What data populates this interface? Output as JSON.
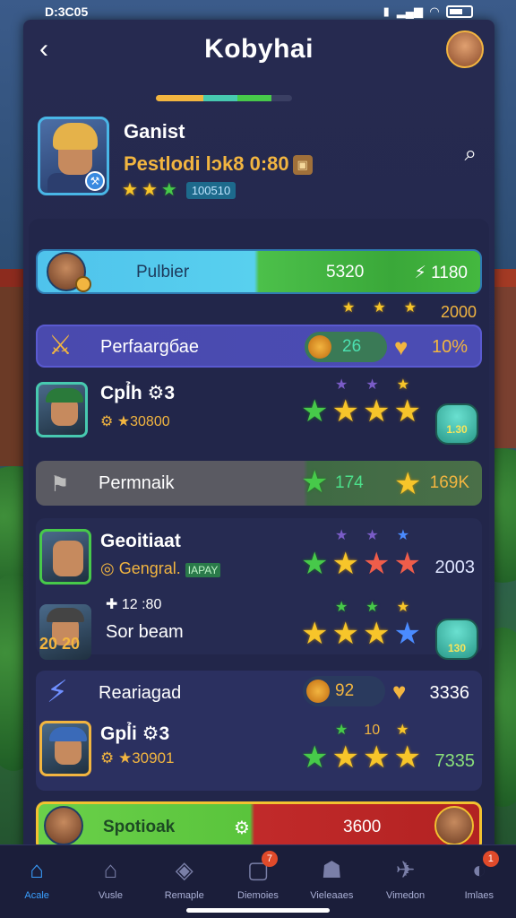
{
  "status_bar": {
    "time": "D:3C05"
  },
  "header": {
    "title": "Kobyhai"
  },
  "progress_segments": [
    {
      "color": "#f2b540",
      "fraction": 0.35
    },
    {
      "color": "#47c9b0",
      "fraction": 0.25
    },
    {
      "color": "#47c94a",
      "fraction": 0.25
    }
  ],
  "profile": {
    "name": "Ganist",
    "subtitle": "Pestlodi lɔk8 0:80",
    "score": "100510"
  },
  "rows": {
    "r1": {
      "label": "Pulbier",
      "value1": "5320",
      "value2": "⚡ 1180"
    },
    "r1b": {
      "value": "2000"
    },
    "r2": {
      "label": "Perfaargбае",
      "pill": "26",
      "value": "10%"
    },
    "r3": {
      "name": "Cpl̉h ⚙3",
      "sub": "⚙ ★30800",
      "gem": "1.30"
    },
    "r4": {
      "label": "Permnaik",
      "value1": "174",
      "value2": "169K"
    },
    "g1": {
      "name": "Geoitiaat",
      "sub": "◎ Gengral.",
      "tag": "IAPAY",
      "value": "2003"
    },
    "g2": {
      "sub": "✚ 12 :80",
      "name": "Sor beam",
      "level": "20 20",
      "gem": "130"
    },
    "g3": {
      "label": "Reariagad",
      "pill": "92",
      "value": "3336"
    },
    "g4": {
      "name": "Gpl̉i ⚙3",
      "sub": "⚙ ★30901",
      "mid": "10",
      "value": "7335"
    },
    "last": {
      "label": "Spotioak",
      "value": "3600"
    }
  },
  "tabs": [
    {
      "label": "Acale",
      "icon": "home-icon",
      "active": true
    },
    {
      "label": "Vusle",
      "icon": "house-icon"
    },
    {
      "label": "Remaple",
      "icon": "cube-icon"
    },
    {
      "label": "Diemoies",
      "icon": "card-icon",
      "badge": "7"
    },
    {
      "label": "Vieleaaes",
      "icon": "people-icon"
    },
    {
      "label": "Vimedon",
      "icon": "megaphone-icon"
    },
    {
      "label": "Imlaes",
      "icon": "globe-icon",
      "badge": "1"
    }
  ]
}
